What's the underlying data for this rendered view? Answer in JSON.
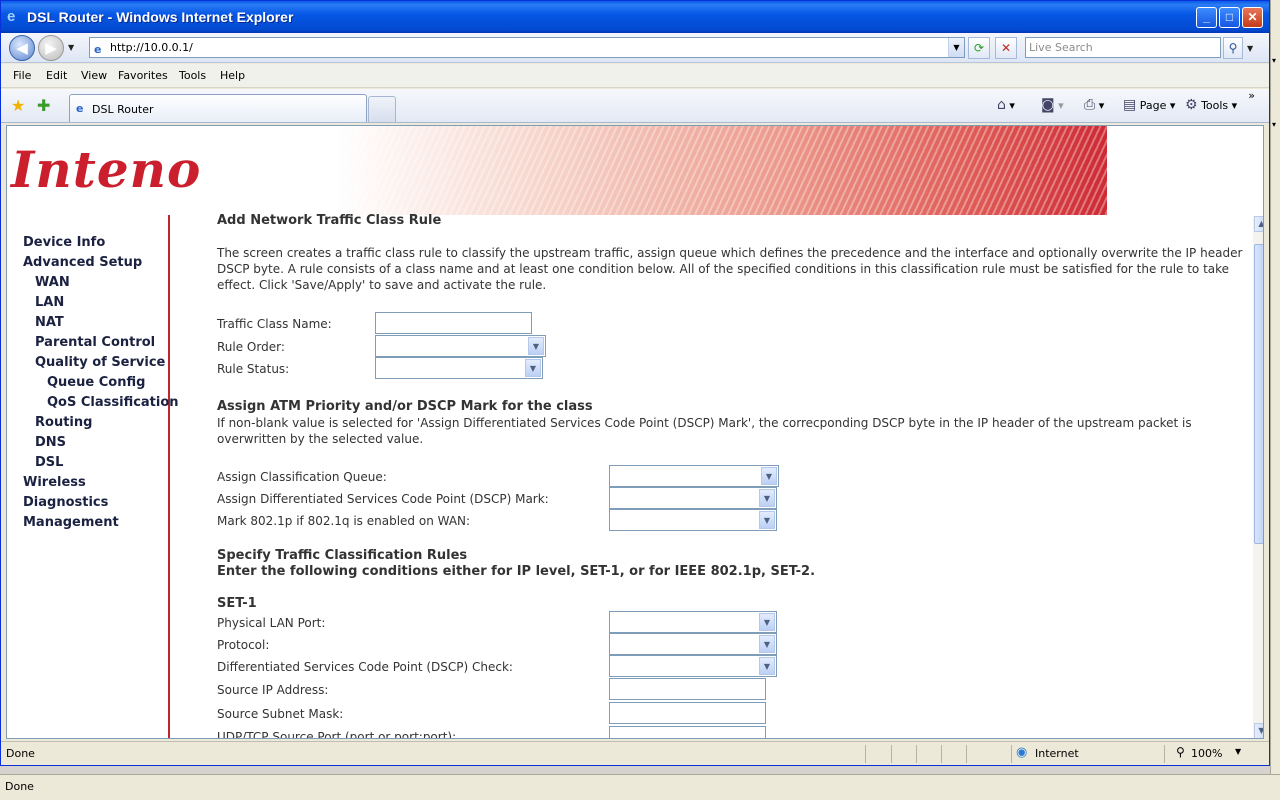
{
  "window": {
    "title": "DSL Router - Windows Internet Explorer",
    "minimize": "_",
    "maximize": "□",
    "close": "✕"
  },
  "address_bar": {
    "url": "http://10.0.0.1/",
    "search_placeholder": "Live Search"
  },
  "menu": [
    "File",
    "Edit",
    "View",
    "Favorites",
    "Tools",
    "Help"
  ],
  "tab": {
    "label": "DSL Router"
  },
  "toolbar": {
    "page_label": "Page",
    "tools_label": "Tools"
  },
  "brand": {
    "logo_text": "Inteno",
    "logo_color": "#cc1f2d"
  },
  "sidebar": {
    "items": [
      {
        "label": "Device Info",
        "level": 0
      },
      {
        "label": "Advanced Setup",
        "level": 0
      },
      {
        "label": "WAN",
        "level": 1
      },
      {
        "label": "LAN",
        "level": 1
      },
      {
        "label": "NAT",
        "level": 1
      },
      {
        "label": "Parental Control",
        "level": 1
      },
      {
        "label": "Quality of Service",
        "level": 1
      },
      {
        "label": "Queue Config",
        "level": 2
      },
      {
        "label": "QoS Classification",
        "level": 2
      },
      {
        "label": "Routing",
        "level": 1
      },
      {
        "label": "DNS",
        "level": 1
      },
      {
        "label": "DSL",
        "level": 1
      },
      {
        "label": "Wireless",
        "level": 0
      },
      {
        "label": "Diagnostics",
        "level": 0
      },
      {
        "label": "Management",
        "level": 0
      }
    ]
  },
  "main": {
    "title": "Add Network Traffic Class Rule",
    "intro_lines": [
      "The screen creates a traffic class rule to classify the upstream traffic, assign queue which defines the precedence and the interface and optionally overwrite the IP header",
      "DSCP byte. A rule consists of a class name and at least one condition below. All of the specified conditions in this classification rule must be satisfied for the rule to take",
      "effect. Click 'Save/Apply' to save and activate the rule."
    ],
    "traffic_class_name_label": "Traffic Class Name:",
    "traffic_class_name_value": "",
    "rule_order_label": "Rule Order:",
    "rule_status_label": "Rule Status:",
    "atm_title": "Assign ATM Priority and/or DSCP Mark for the class",
    "atm_lines": [
      "If non-blank value is selected for 'Assign Differentiated Services Code Point (DSCP) Mark', the correcponding DSCP byte in the IP header of the upstream packet is",
      "overwritten by the selected value."
    ],
    "classification_queue_label": "Assign Classification Queue:",
    "dscp_mark_label": "Assign Differentiated Services Code Point (DSCP) Mark:",
    "mark_8021p_label": "Mark 802.1p if 802.1q is enabled on WAN:",
    "rules_title_1": "Specify Traffic Classification Rules",
    "rules_title_2": "Enter the following conditions either for IP level, SET-1, or for IEEE 802.1p, SET-2.",
    "set1_title": "SET-1",
    "physical_lan_port_label": "Physical LAN Port:",
    "protocol_label": "Protocol:",
    "dscp_check_label": "Differentiated Services Code Point (DSCP) Check:",
    "source_ip_label": "Source IP Address:",
    "source_mask_label": "Source Subnet Mask:",
    "source_port_label": "UDP/TCP Source Port (port or port:port):"
  },
  "status": {
    "left": "Done",
    "zone": "Internet",
    "zoom": "100%",
    "outer": "Done"
  }
}
